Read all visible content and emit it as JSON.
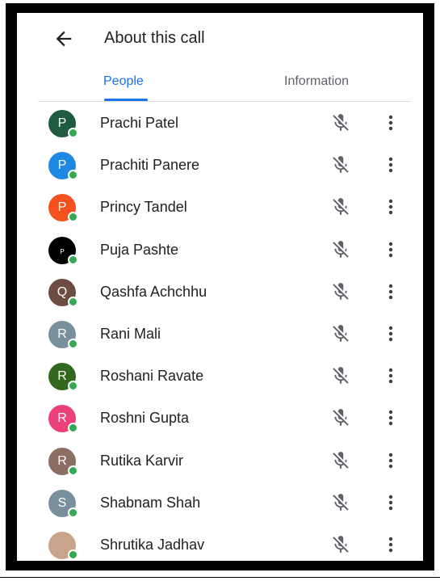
{
  "header": {
    "title": "About this call",
    "back_icon": "arrow-back-icon"
  },
  "tabs": [
    {
      "label": "People",
      "selected": true
    },
    {
      "label": "Information",
      "selected": false
    }
  ],
  "colors": {
    "accent": "#1a73e8",
    "presence": "#34a853",
    "text": "#202124",
    "muted_icon": "#5f6368"
  },
  "participants": [
    {
      "name": "Prachi Patel",
      "initial": "P",
      "avatar_color": "#1e5b3f"
    },
    {
      "name": "Prachiti Panere",
      "initial": "P",
      "avatar_color": "#1e88e5"
    },
    {
      "name": "Princy Tandel",
      "initial": "P",
      "avatar_color": "#f4511e"
    },
    {
      "name": "Puja Pashte",
      "initial": "P",
      "avatar_color": "#000000"
    },
    {
      "name": "Qashfa Achchhu",
      "initial": "Q",
      "avatar_color": "#6d4c41"
    },
    {
      "name": "Rani Mali",
      "initial": "R",
      "avatar_color": "#78909c"
    },
    {
      "name": "Roshani Ravate",
      "initial": "R",
      "avatar_color": "#33691e"
    },
    {
      "name": "Roshni Gupta",
      "initial": "R",
      "avatar_color": "#ec407a"
    },
    {
      "name": "Rutika Karvir",
      "initial": "R",
      "avatar_color": "#8d6e63"
    },
    {
      "name": "Shabnam Shah",
      "initial": "S",
      "avatar_color": "#78909c"
    },
    {
      "name": "Shrutika Jadhav",
      "initial": "",
      "avatar_color": "#c9a48a"
    }
  ],
  "row_icons": {
    "mic": "mic-off-icon",
    "more": "more-vert-icon"
  }
}
